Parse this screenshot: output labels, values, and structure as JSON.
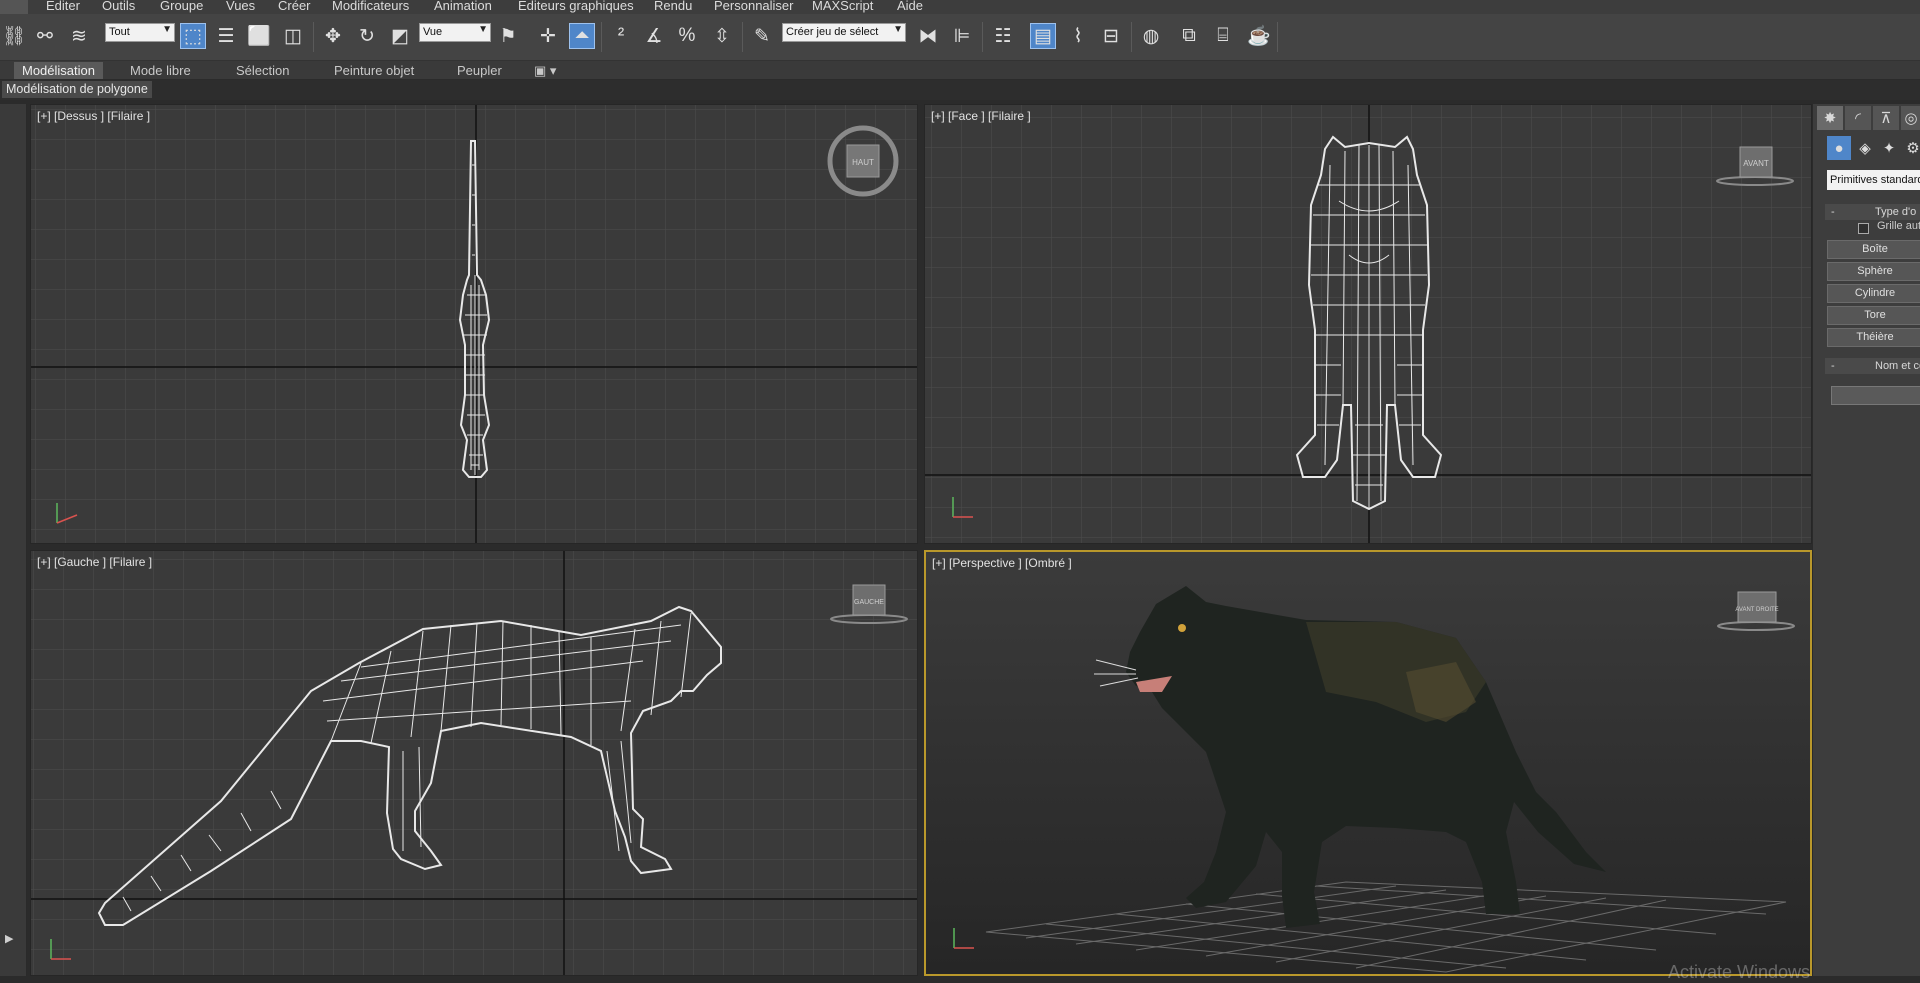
{
  "menu": [
    "Editer",
    "Outils",
    "Groupe",
    "Vues",
    "Créer",
    "Modificateurs",
    "Animation",
    "Editeurs graphiques",
    "Rendu",
    "Personnaliser",
    "MAXScript",
    "Aide"
  ],
  "toolbar": {
    "selection_filter": "Tout",
    "ref_coord": "Vue",
    "named_selection": "Créer jeu de sélect"
  },
  "ribbon": {
    "tabs": [
      "Modélisation",
      "Mode libre",
      "Sélection",
      "Peinture objet",
      "Peupler"
    ],
    "active_tab": "Modélisation",
    "subpanel": "Modélisation de polygone"
  },
  "viewports": {
    "top": {
      "label": "[+] [Dessus ] [Filaire ]",
      "cube": "HAUT"
    },
    "front": {
      "label": "[+] [Face ] [Filaire ]",
      "cube": "AVANT"
    },
    "left": {
      "label": "[+] [Gauche ] [Filaire ]",
      "cube": "GAUCHE"
    },
    "perspective": {
      "label": "[+] [Perspective ] [Ombré ]",
      "cube": "AVANT DROITE"
    }
  },
  "command_panel": {
    "category": "Primitives standard",
    "type_rollout": "Type d'o",
    "auto_grid": "Grille aut",
    "buttons": [
      "Boîte",
      "Sphère",
      "Cylindre",
      "Tore",
      "Théière"
    ],
    "name_rollout": "Nom et co"
  },
  "watermark": "Activate Windows",
  "colors": {
    "accent": "#4f86c9",
    "active_viewport_border": "#b9982b",
    "grid": "#4a4a4a",
    "wire": "#e8e8e8"
  }
}
